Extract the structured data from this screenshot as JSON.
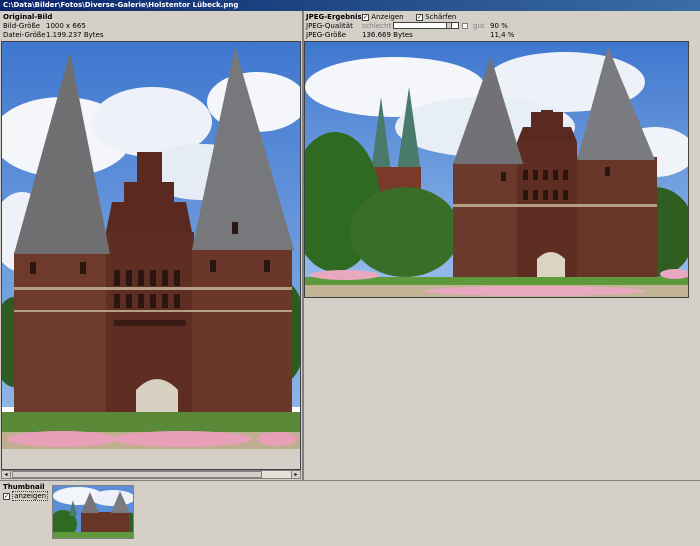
{
  "window": {
    "title": "C:\\Data\\Bilder\\Fotos\\Diverse-Galerie\\Holstentor Lübeck.png"
  },
  "original": {
    "heading": "Original-Bild",
    "size_label": "Bild-Größe",
    "size_value": "1000 x 665",
    "filesize_label": "Datei-Größe",
    "filesize_value": "1.199.237 Bytes"
  },
  "jpeg": {
    "heading": "JPEG-Ergebnis",
    "show_label": "Anzeigen",
    "show_checked": true,
    "sharpen_label": "Schärfen",
    "sharpen_checked": true,
    "quality_label": "JPEG-Qualität",
    "quality_low": "schlecht",
    "quality_high": "gut",
    "quality_value": "90 %",
    "quality_fraction": 0.9,
    "size_label": "JPEG-Größe",
    "size_value": "136.669 Bytes",
    "size_ratio": "11,4 %"
  },
  "thumbnail": {
    "heading": "Thumbnail",
    "show_label": "anzeigen",
    "show_checked": true
  },
  "colors": {
    "titlebar_start": "#0a246a",
    "titlebar_end": "#3a6ea5",
    "window_bg": "#d4d0c8"
  }
}
